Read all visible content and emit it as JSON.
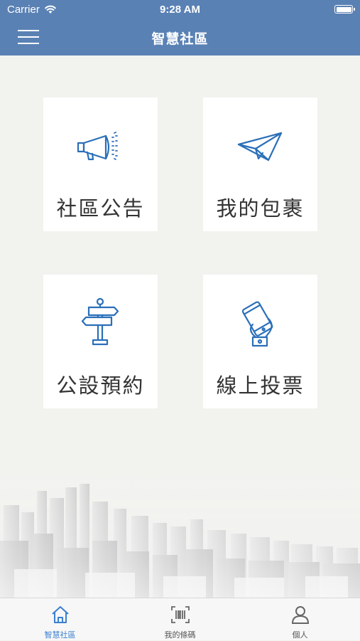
{
  "status_bar": {
    "carrier": "Carrier",
    "time": "9:28 AM"
  },
  "header": {
    "title": "智慧社區",
    "menu_icon": "hamburger-icon"
  },
  "tiles": [
    {
      "label": "社區公告",
      "icon": "megaphone-icon"
    },
    {
      "label": "我的包裹",
      "icon": "paper-plane-icon"
    },
    {
      "label": "公設預約",
      "icon": "signpost-icon"
    },
    {
      "label": "線上投票",
      "icon": "phone-vote-icon"
    }
  ],
  "tabs": [
    {
      "label": "智慧社區",
      "icon": "home-icon",
      "active": true
    },
    {
      "label": "我的條碼",
      "icon": "barcode-icon",
      "active": false
    },
    {
      "label": "個人",
      "icon": "person-icon",
      "active": false
    }
  ],
  "colors": {
    "header": "#5a81b4",
    "icon": "#2a6fb8",
    "tab_active": "#3a7fd0",
    "background": "#f2f2ef"
  }
}
